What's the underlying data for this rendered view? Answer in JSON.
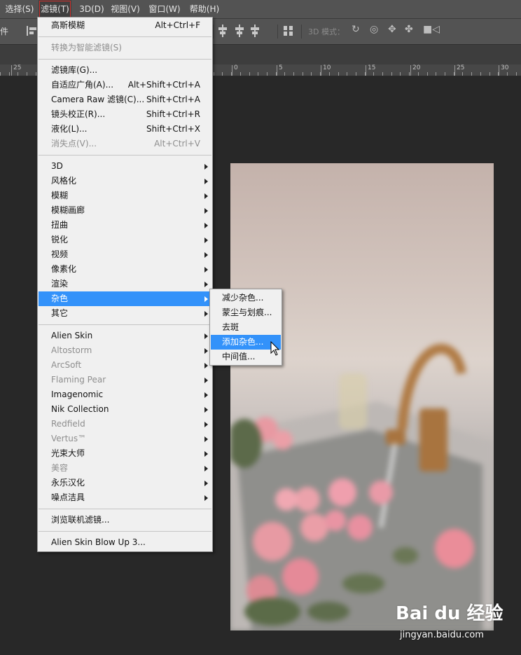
{
  "menubar": {
    "items": [
      {
        "label": "选择(S)"
      },
      {
        "label": "滤镜(T)",
        "active": true
      },
      {
        "label": "3D(D)"
      },
      {
        "label": "视图(V)"
      },
      {
        "label": "窗口(W)"
      },
      {
        "label": "帮助(H)"
      }
    ]
  },
  "toolbar": {
    "left_fragment": "件",
    "mode_3d_label": "3D 模式："
  },
  "ruler": {
    "labels": [
      "25",
      "0",
      "5",
      "10",
      "15",
      "20",
      "25",
      "30"
    ]
  },
  "filter_menu": {
    "groups": [
      [
        {
          "label": "高斯模糊",
          "shortcut": "Alt+Ctrl+F"
        }
      ],
      [
        {
          "label": "转换为智能滤镜(S)",
          "disabled": true
        }
      ],
      [
        {
          "label": "滤镜库(G)..."
        },
        {
          "label": "自适应广角(A)...",
          "shortcut": "Alt+Shift+Ctrl+A"
        },
        {
          "label": "Camera Raw 滤镜(C)...",
          "shortcut": "Shift+Ctrl+A"
        },
        {
          "label": "镜头校正(R)...",
          "shortcut": "Shift+Ctrl+R"
        },
        {
          "label": "液化(L)...",
          "shortcut": "Shift+Ctrl+X"
        },
        {
          "label": "消失点(V)...",
          "shortcut": "Alt+Ctrl+V",
          "disabled": true
        }
      ],
      [
        {
          "label": "3D",
          "submenu": true
        },
        {
          "label": "风格化",
          "submenu": true
        },
        {
          "label": "模糊",
          "submenu": true
        },
        {
          "label": "模糊画廊",
          "submenu": true
        },
        {
          "label": "扭曲",
          "submenu": true
        },
        {
          "label": "锐化",
          "submenu": true
        },
        {
          "label": "视频",
          "submenu": true
        },
        {
          "label": "像素化",
          "submenu": true
        },
        {
          "label": "渲染",
          "submenu": true
        },
        {
          "label": "杂色",
          "submenu": true,
          "highlighted": true
        },
        {
          "label": "其它",
          "submenu": true
        }
      ],
      [
        {
          "label": "Alien Skin",
          "submenu": true
        },
        {
          "label": "Altostorm",
          "submenu": true,
          "disabled": true
        },
        {
          "label": "ArcSoft",
          "submenu": true,
          "disabled": true
        },
        {
          "label": "Flaming Pear",
          "submenu": true,
          "disabled": true
        },
        {
          "label": "Imagenomic",
          "submenu": true
        },
        {
          "label": "Nik Collection",
          "submenu": true
        },
        {
          "label": "Redfield",
          "submenu": true,
          "disabled": true
        },
        {
          "label": "Vertus™",
          "submenu": true,
          "disabled": true
        },
        {
          "label": "光束大师",
          "submenu": true
        },
        {
          "label": "美容",
          "submenu": true,
          "disabled": true
        },
        {
          "label": "永乐汉化",
          "submenu": true
        },
        {
          "label": "噪点洁具",
          "submenu": true
        }
      ],
      [
        {
          "label": "浏览联机滤镜..."
        }
      ],
      [
        {
          "label": "Alien Skin Blow Up 3..."
        }
      ]
    ]
  },
  "noise_submenu": {
    "items": [
      {
        "label": "减少杂色..."
      },
      {
        "label": "蒙尘与划痕..."
      },
      {
        "label": "去斑"
      },
      {
        "label": "添加杂色...",
        "highlighted": true
      },
      {
        "label": "中间值..."
      }
    ]
  },
  "watermark": {
    "brand": "Bai du 经验",
    "url": "jingyan.baidu.com"
  },
  "colors": {
    "highlight": "#3392fa",
    "workspace": "#282828",
    "menu_bg": "#f0f0f0"
  }
}
